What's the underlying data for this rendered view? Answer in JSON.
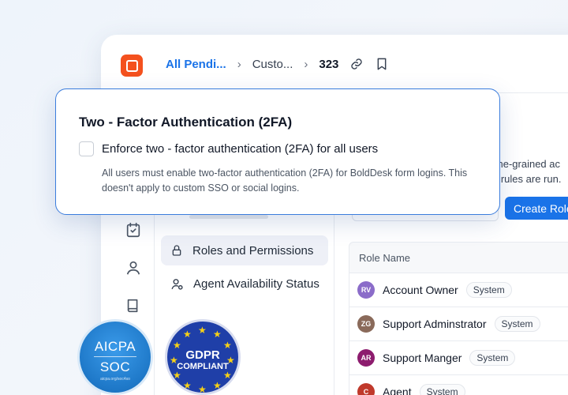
{
  "breadcrumb": {
    "root": "All Pendi...",
    "middle": "Custo...",
    "current": "323"
  },
  "settings_menu": {
    "items": [
      {
        "label": "Roles and Permissions",
        "active": true
      },
      {
        "label": "Agent Availability Status",
        "active": false
      }
    ]
  },
  "roles_page": {
    "description_line1": "fine-grained ac",
    "description_line2": "n rules are run.",
    "create_button": "Create Role",
    "table_header": "Role Name",
    "rows": [
      {
        "initials": "RV",
        "name": "Account Owner",
        "tag": "System",
        "avatar_color": "#8b6cc9"
      },
      {
        "initials": "ZG",
        "name": "Support Adminstrator",
        "tag": "System",
        "avatar_color": "#8a6a5a"
      },
      {
        "initials": "AR",
        "name": "Support Manger",
        "tag": "System",
        "avatar_color": "#8d1c6e"
      },
      {
        "initials": "C",
        "name": "Agent",
        "tag": "System",
        "avatar_color": "#c0392b"
      }
    ]
  },
  "tfa_card": {
    "title": "Two - Factor Authentication (2FA)",
    "checkbox_label": "Enforce two - factor authentication (2FA) for all users",
    "checkbox_checked": false,
    "note": "All users must enable two-factor authentication (2FA) for BoldDesk form logins. This doesn't apply to custom SSO or social logins."
  },
  "badges": {
    "aicpa_line1": "AICPA",
    "aicpa_line2": "SOC",
    "aicpa_url": "aicpa.org/soc4so",
    "gdpr_line1": "GDPR",
    "gdpr_line2": "COMPLIANT"
  },
  "colors": {
    "brand_orange": "#f4511e",
    "primary_blue": "#1a73e8",
    "card_border": "#3b7ddd"
  }
}
